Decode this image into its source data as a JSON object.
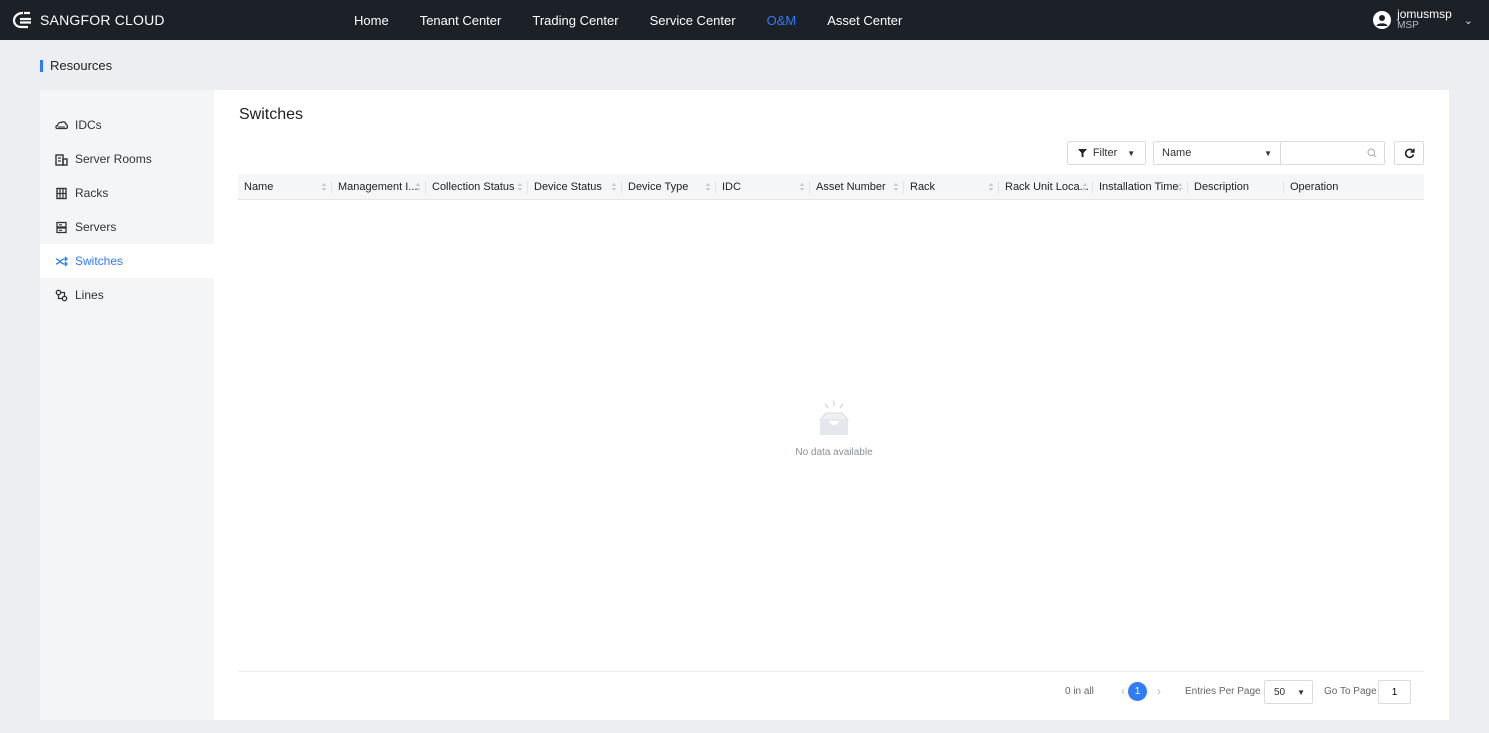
{
  "app": {
    "brand": "SANGFOR CLOUD"
  },
  "nav": {
    "items": [
      {
        "label": "Home",
        "active": false
      },
      {
        "label": "Tenant Center",
        "active": false
      },
      {
        "label": "Trading Center",
        "active": false
      },
      {
        "label": "Service Center",
        "active": false
      },
      {
        "label": "O&M",
        "active": true
      },
      {
        "label": "Asset Center",
        "active": false
      }
    ]
  },
  "user": {
    "name": "jomusmsp",
    "role": "MSP",
    "icon": "user-avatar-icon"
  },
  "page": {
    "title": "Resources"
  },
  "sidebar": {
    "items": [
      {
        "label": "IDCs",
        "icon": "cloud-icon",
        "active": false
      },
      {
        "label": "Server Rooms",
        "icon": "building-icon",
        "active": false
      },
      {
        "label": "Racks",
        "icon": "rack-icon",
        "active": false
      },
      {
        "label": "Servers",
        "icon": "server-icon",
        "active": false
      },
      {
        "label": "Switches",
        "icon": "switch-icon",
        "active": true
      },
      {
        "label": "Lines",
        "icon": "link-icon",
        "active": false
      }
    ]
  },
  "main": {
    "title": "Switches",
    "toolbar": {
      "filter_label": "Filter",
      "search_field": "Name",
      "search_value": ""
    },
    "table": {
      "columns": [
        "Name",
        "Management I...",
        "Collection Status",
        "Device Status",
        "Device Type",
        "IDC",
        "Asset Number",
        "Rack",
        "Rack Unit Loca...",
        "Installation Time",
        "Description",
        "Operation"
      ],
      "rows": []
    },
    "empty_text": "No data available",
    "pagination": {
      "total_text": "0 in all",
      "current_page": "1",
      "entries_label": "Entries Per Page",
      "entries_value": "50",
      "goto_label": "Go To Page",
      "goto_value": "1"
    }
  },
  "colors": {
    "accent": "#2f7cf6",
    "topbar": "#1c2027",
    "background": "#eceef1"
  }
}
